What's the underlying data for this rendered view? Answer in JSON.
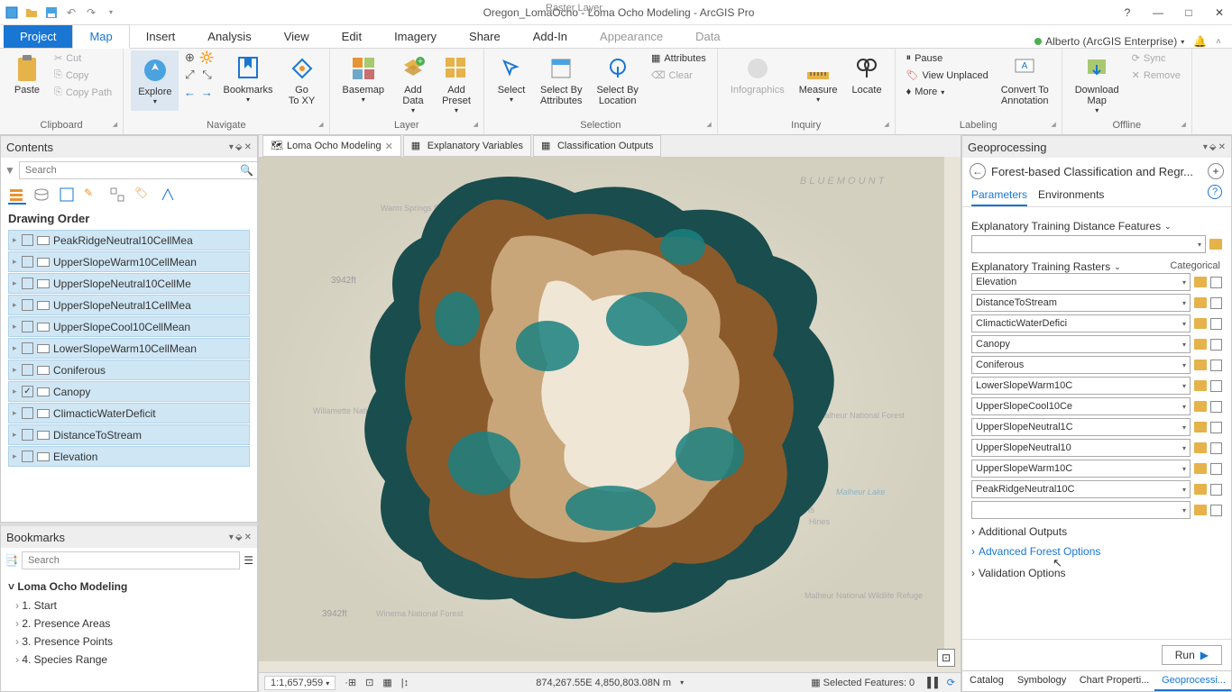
{
  "title": "Oregon_LomaOcho - Loma Ocho Modeling - ArcGIS Pro",
  "context_tab": "Raster Layer",
  "user": "Alberto (ArcGIS Enterprise)",
  "file_tabs": [
    "Project",
    "Map",
    "Insert",
    "Analysis",
    "View",
    "Edit",
    "Imagery",
    "Share",
    "Add-In",
    "Appearance",
    "Data"
  ],
  "active_file_tab": "Map",
  "ribbon": {
    "clipboard": {
      "label": "Clipboard",
      "paste": "Paste",
      "cut": "Cut",
      "copy": "Copy",
      "copypath": "Copy Path"
    },
    "navigate": {
      "label": "Navigate",
      "explore": "Explore",
      "bookmarks": "Bookmarks",
      "goto": "Go\nTo XY"
    },
    "layer": {
      "label": "Layer",
      "basemap": "Basemap",
      "adddata": "Add\nData",
      "addpreset": "Add\nPreset"
    },
    "selection": {
      "label": "Selection",
      "select": "Select",
      "byattr": "Select By\nAttributes",
      "byloc": "Select By\nLocation",
      "attributes": "Attributes",
      "clear": "Clear"
    },
    "inquiry": {
      "label": "Inquiry",
      "infog": "Infographics",
      "measure": "Measure",
      "locate": "Locate"
    },
    "labeling": {
      "label": "Labeling",
      "pause": "Pause",
      "unplaced": "View Unplaced",
      "more": "More",
      "convert": "Convert To\nAnnotation"
    },
    "offline": {
      "label": "Offline",
      "download": "Download\nMap",
      "sync": "Sync",
      "remove": "Remove"
    }
  },
  "contents": {
    "title": "Contents",
    "search_ph": "Search",
    "section": "Drawing Order",
    "layers": [
      {
        "name": "PeakRidgeNeutral10CellMea",
        "checked": false
      },
      {
        "name": "UpperSlopeWarm10CellMean",
        "checked": false
      },
      {
        "name": "UpperSlopeNeutral10CellMe",
        "checked": false
      },
      {
        "name": "UpperSlopeNeutral1CellMea",
        "checked": false
      },
      {
        "name": "UpperSlopeCool10CellMean",
        "checked": false
      },
      {
        "name": "LowerSlopeWarm10CellMean",
        "checked": false
      },
      {
        "name": "Coniferous",
        "checked": false
      },
      {
        "name": "Canopy",
        "checked": true
      },
      {
        "name": "ClimacticWaterDeficit",
        "checked": false
      },
      {
        "name": "DistanceToStream",
        "checked": false
      },
      {
        "name": "Elevation",
        "checked": false
      }
    ]
  },
  "bookmarks": {
    "title": "Bookmarks",
    "search_ph": "Search",
    "group": "Loma Ocho Modeling",
    "items": [
      "1. Start",
      "2. Presence Areas",
      "3. Presence Points",
      "4. Species Range"
    ]
  },
  "map_tabs": [
    {
      "name": "Loma Ocho Modeling",
      "active": true,
      "closable": true
    },
    {
      "name": "Explanatory Variables",
      "active": false
    },
    {
      "name": "Classification Outputs",
      "active": false
    }
  ],
  "status": {
    "scale": "1:1,657,959",
    "coords": "874,267.55E 4,850,803.08N m",
    "selected": "Selected Features: 0"
  },
  "gp": {
    "title": "Geoprocessing",
    "tool": "Forest-based Classification and Regr...",
    "tabs": [
      "Parameters",
      "Environments"
    ],
    "param_dist": "Explanatory Training Distance Features",
    "param_rasters": "Explanatory Training Rasters",
    "categorical": "Categorical",
    "rasters": [
      "Elevation",
      "DistanceToStream",
      "ClimacticWaterDefici",
      "Canopy",
      "Coniferous",
      "LowerSlopeWarm10C",
      "UpperSlopeCool10Ce",
      "UpperSlopeNeutral1C",
      "UpperSlopeNeutral10",
      "UpperSlopeWarm10C",
      "PeakRidgeNeutral10C",
      ""
    ],
    "sections": [
      "Additional Outputs",
      "Advanced Forest Options",
      "Validation Options"
    ],
    "run": "Run"
  },
  "bottom_tabs": [
    "Catalog",
    "Symbology",
    "Chart Properti...",
    "Geoprocessi..."
  ]
}
